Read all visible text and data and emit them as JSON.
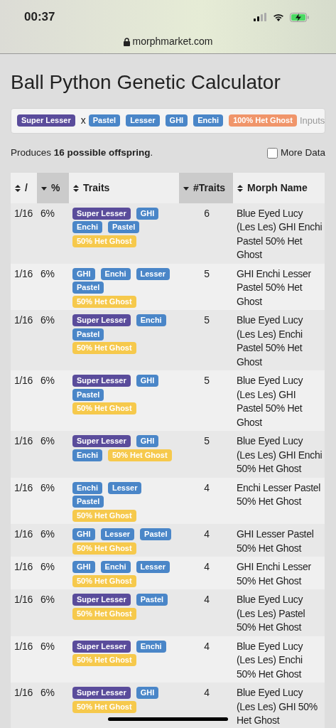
{
  "status_bar": {
    "time": "00:37"
  },
  "browser": {
    "url": "morphmarket.com"
  },
  "title": "Ball Python Genetic Calculator",
  "inputs": {
    "female": [
      {
        "label": "Super Lesser",
        "color": "#5a4c9b"
      }
    ],
    "cross": "x",
    "male": [
      {
        "label": "Pastel",
        "color": "#4a86c8"
      },
      {
        "label": "Lesser",
        "color": "#4a86c8"
      },
      {
        "label": "GHI",
        "color": "#4a86c8"
      },
      {
        "label": "Enchi",
        "color": "#4a86c8"
      },
      {
        "label": "100% Het Ghost",
        "color": "#f0956a"
      }
    ],
    "change_link": "Inputs"
  },
  "summary": "Produces **16 possible offspring**.",
  "more_data": {
    "label": "More Data",
    "checked": false
  },
  "table": {
    "columns": [
      {
        "label": "/",
        "sorted": false
      },
      {
        "label": "%",
        "sorted": true
      },
      {
        "label": "Traits",
        "sorted": false
      },
      {
        "label": "#Traits",
        "sorted": true
      },
      {
        "label": "Morph Name",
        "sorted": false
      }
    ],
    "rows": [
      {
        "odds": "1/16",
        "percent": "6%",
        "traits": [
          {
            "label": "Super Lesser",
            "color": "#5a4c9b"
          },
          {
            "label": "GHI",
            "color": "#4a86c8"
          },
          {
            "label": "Enchi",
            "color": "#4a86c8"
          },
          {
            "label": "Pastel",
            "color": "#4a86c8"
          },
          {
            "label": "50% Het Ghost",
            "color": "#f6c94c"
          }
        ],
        "count": "6",
        "morph": "Blue Eyed Lucy (Les Les) GHI Enchi Pastel 50% Het Ghost"
      },
      {
        "odds": "1/16",
        "percent": "6%",
        "traits": [
          {
            "label": "GHI",
            "color": "#4a86c8"
          },
          {
            "label": "Enchi",
            "color": "#4a86c8"
          },
          {
            "label": "Lesser",
            "color": "#4a86c8"
          },
          {
            "label": "Pastel",
            "color": "#4a86c8"
          },
          {
            "label": "50% Het Ghost",
            "color": "#f6c94c"
          }
        ],
        "count": "5",
        "morph": "GHI Enchi Lesser Pastel 50% Het Ghost"
      },
      {
        "odds": "1/16",
        "percent": "6%",
        "traits": [
          {
            "label": "Super Lesser",
            "color": "#5a4c9b"
          },
          {
            "label": "Enchi",
            "color": "#4a86c8"
          },
          {
            "label": "Pastel",
            "color": "#4a86c8"
          },
          {
            "label": "50% Het Ghost",
            "color": "#f6c94c"
          }
        ],
        "count": "5",
        "morph": "Blue Eyed Lucy (Les Les) Enchi Pastel 50% Het Ghost"
      },
      {
        "odds": "1/16",
        "percent": "6%",
        "traits": [
          {
            "label": "Super Lesser",
            "color": "#5a4c9b"
          },
          {
            "label": "GHI",
            "color": "#4a86c8"
          },
          {
            "label": "Pastel",
            "color": "#4a86c8"
          },
          {
            "label": "50% Het Ghost",
            "color": "#f6c94c"
          }
        ],
        "count": "5",
        "morph": "Blue Eyed Lucy (Les Les) GHI Pastel 50% Het Ghost"
      },
      {
        "odds": "1/16",
        "percent": "6%",
        "traits": [
          {
            "label": "Super Lesser",
            "color": "#5a4c9b"
          },
          {
            "label": "GHI",
            "color": "#4a86c8"
          },
          {
            "label": "Enchi",
            "color": "#4a86c8"
          },
          {
            "label": "50% Het Ghost",
            "color": "#f6c94c"
          }
        ],
        "count": "5",
        "morph": "Blue Eyed Lucy (Les Les) GHI Enchi 50% Het Ghost"
      },
      {
        "odds": "1/16",
        "percent": "6%",
        "traits": [
          {
            "label": "Enchi",
            "color": "#4a86c8"
          },
          {
            "label": "Lesser",
            "color": "#4a86c8"
          },
          {
            "label": "Pastel",
            "color": "#4a86c8"
          },
          {
            "label": "50% Het Ghost",
            "color": "#f6c94c"
          }
        ],
        "count": "4",
        "morph": "Enchi Lesser Pastel 50% Het Ghost"
      },
      {
        "odds": "1/16",
        "percent": "6%",
        "traits": [
          {
            "label": "GHI",
            "color": "#4a86c8"
          },
          {
            "label": "Lesser",
            "color": "#4a86c8"
          },
          {
            "label": "Pastel",
            "color": "#4a86c8"
          },
          {
            "label": "50% Het Ghost",
            "color": "#f6c94c"
          }
        ],
        "count": "4",
        "morph": "GHI Lesser Pastel 50% Het Ghost"
      },
      {
        "odds": "1/16",
        "percent": "6%",
        "traits": [
          {
            "label": "GHI",
            "color": "#4a86c8"
          },
          {
            "label": "Enchi",
            "color": "#4a86c8"
          },
          {
            "label": "Lesser",
            "color": "#4a86c8"
          },
          {
            "label": "50% Het Ghost",
            "color": "#f6c94c"
          }
        ],
        "count": "4",
        "morph": "GHI Enchi Lesser 50% Het Ghost"
      },
      {
        "odds": "1/16",
        "percent": "6%",
        "traits": [
          {
            "label": "Super Lesser",
            "color": "#5a4c9b"
          },
          {
            "label": "Pastel",
            "color": "#4a86c8"
          },
          {
            "label": "50% Het Ghost",
            "color": "#f6c94c"
          }
        ],
        "count": "4",
        "morph": "Blue Eyed Lucy (Les Les) Pastel 50% Het Ghost"
      },
      {
        "odds": "1/16",
        "percent": "6%",
        "traits": [
          {
            "label": "Super Lesser",
            "color": "#5a4c9b"
          },
          {
            "label": "Enchi",
            "color": "#4a86c8"
          },
          {
            "label": "50% Het Ghost",
            "color": "#f6c94c"
          }
        ],
        "count": "4",
        "morph": "Blue Eyed Lucy (Les Les) Enchi 50% Het Ghost"
      },
      {
        "odds": "1/16",
        "percent": "6%",
        "traits": [
          {
            "label": "Super Lesser",
            "color": "#5a4c9b"
          },
          {
            "label": "GHI",
            "color": "#4a86c8"
          },
          {
            "label": "50% Het Ghost",
            "color": "#f6c94c"
          }
        ],
        "count": "4",
        "morph": "Blue Eyed Lucy (Les Les) GHI 50% Het Ghost"
      }
    ]
  }
}
